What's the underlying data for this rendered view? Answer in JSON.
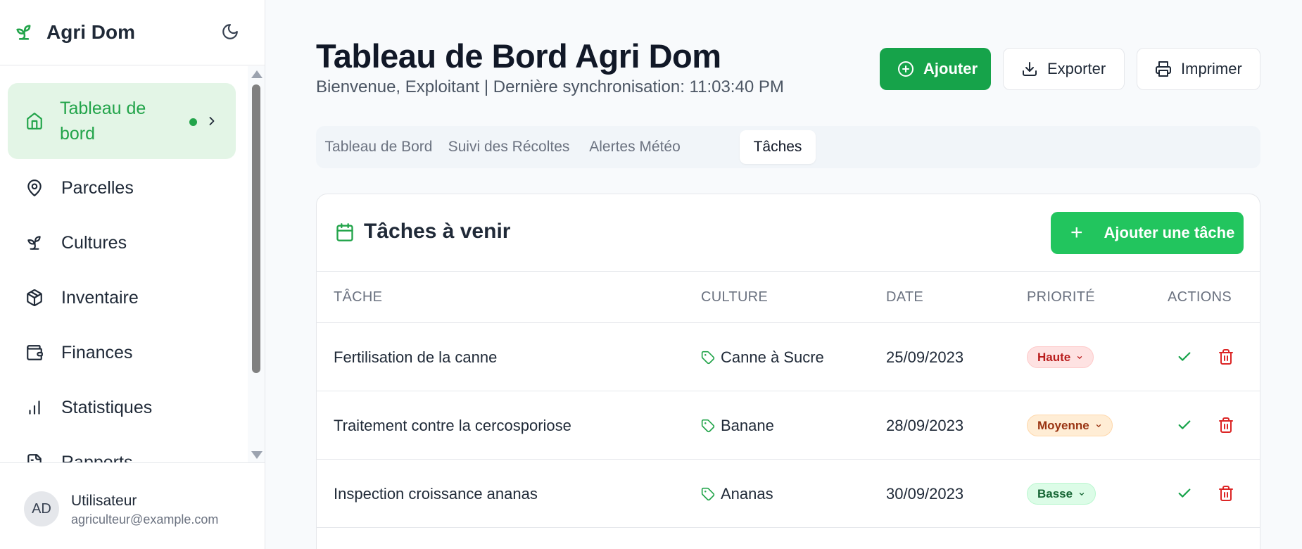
{
  "app": {
    "name": "Agri Dom"
  },
  "sidebar": {
    "items": [
      {
        "label": "Tableau de bord",
        "icon": "home-icon",
        "active": true
      },
      {
        "label": "Parcelles",
        "icon": "map-pin-icon"
      },
      {
        "label": "Cultures",
        "icon": "sprout-icon"
      },
      {
        "label": "Inventaire",
        "icon": "package-icon"
      },
      {
        "label": "Finances",
        "icon": "wallet-icon"
      },
      {
        "label": "Statistiques",
        "icon": "bar-chart-icon"
      },
      {
        "label": "Rapports",
        "icon": "file-icon"
      }
    ],
    "user": {
      "initials": "AD",
      "name": "Utilisateur",
      "email": "agriculteur@example.com"
    }
  },
  "header": {
    "title": "Tableau de Bord Agri Dom",
    "subtitle": "Bienvenue, Exploitant | Dernière synchronisation: 11:03:40 PM",
    "buttons": {
      "add": "Ajouter",
      "export": "Exporter",
      "print": "Imprimer"
    }
  },
  "tabs": [
    {
      "label": "Tableau de Bord",
      "active": false
    },
    {
      "label": "Suivi des Récoltes",
      "active": false
    },
    {
      "label": "Alertes Météo",
      "active": false
    },
    {
      "label": "Tâches",
      "active": true
    }
  ],
  "tasks_card": {
    "title": "Tâches à venir",
    "add_button": "Ajouter une tâche",
    "columns": [
      "TÂCHE",
      "CULTURE",
      "DATE",
      "PRIORITÉ",
      "ACTIONS"
    ],
    "rows": [
      {
        "task": "Fertilisation de la canne",
        "crop": "Canne à Sucre",
        "date": "25/09/2023",
        "priority": "Haute"
      },
      {
        "task": "Traitement contre la cercosporiose",
        "crop": "Banane",
        "date": "28/09/2023",
        "priority": "Moyenne"
      },
      {
        "task": "Inspection croissance ananas",
        "crop": "Ananas",
        "date": "30/09/2023",
        "priority": "Basse"
      }
    ]
  },
  "colors": {
    "primary_green": "#16a34a",
    "accent_green": "#22c55e",
    "priority_high": "#b91c1c",
    "priority_medium": "#9a3412",
    "priority_low": "#15803d",
    "delete_red": "#dc2626"
  }
}
